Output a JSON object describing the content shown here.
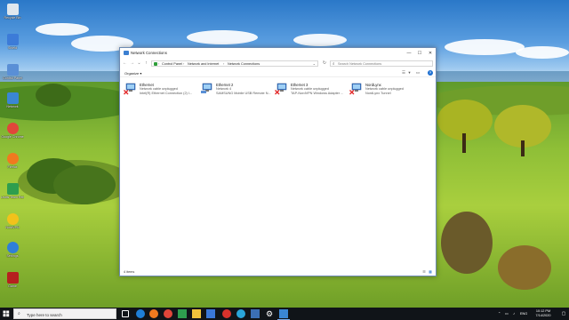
{
  "window": {
    "title": "Network Connections",
    "controls": {
      "minimize": "—",
      "maximize": "☐",
      "close": "✕"
    }
  },
  "addressbar": {
    "back": "←",
    "forward": "→",
    "recent": "⌄",
    "up": "↑",
    "crumbs": [
      "Control Panel",
      "Network and Internet",
      "Network Connections"
    ],
    "separator": "›",
    "dropdown": "⌄",
    "refresh": "↻",
    "search_placeholder": "Search Network Connections",
    "search_glyph": "⌕"
  },
  "commandbar": {
    "organize": "Organize ▾",
    "view_glyph": "☰",
    "view_dropdown": "▾",
    "pane_glyph": "▭",
    "help": "?"
  },
  "adapters": [
    {
      "name": "Ethernet",
      "status": "Network cable unplugged",
      "device": "Intel(R) Ethernet Connection (2) I..."
    },
    {
      "name": "Ethernet 2",
      "status": "Network 4",
      "device": "SAMSUNG Mobile USB Remote N..."
    },
    {
      "name": "Ethernet 3",
      "status": "Network cable unplugged",
      "device": "TAP-NordVPN Windows Adapter ..."
    },
    {
      "name": "NordLynx",
      "status": "Network cable unplugged",
      "device": "NordLynx Tunnel"
    }
  ],
  "statusbar": {
    "count": "4 items",
    "details_glyph": "☰",
    "tiles_glyph": "▦"
  },
  "desktop_icons": [
    {
      "label": "Recycle Bin",
      "icon": "recycle-bin-icon",
      "color": "#dfe7ee"
    },
    {
      "label": "Shield",
      "icon": "shield-app-icon",
      "color": "#3c7bd8"
    },
    {
      "label": "Control Panel",
      "icon": "control-panel-icon",
      "color": "#5a8fd6"
    },
    {
      "label": "Network",
      "icon": "network-icon",
      "color": "#3a86d4"
    },
    {
      "label": "Google Chrome",
      "icon": "chrome-icon",
      "color": "#e0463a"
    },
    {
      "label": "Firefox",
      "icon": "firefox-icon",
      "color": "#f07a1f"
    },
    {
      "label": "Lewis Team Remove",
      "icon": "green-app-icon",
      "color": "#2e9e4e"
    },
    {
      "label": "NordVPN",
      "icon": "yellow-app-icon",
      "color": "#f2c21b"
    },
    {
      "label": "Settings",
      "icon": "blue-app-icon",
      "color": "#2f7fd8"
    },
    {
      "label": "Game",
      "icon": "game-icon",
      "color": "#b6201f"
    }
  ],
  "taskbar": {
    "search_text": "Type here to search",
    "search_glyph": "⌕",
    "apps": [
      {
        "name": "task-view-icon",
        "color": "#ffffff"
      },
      {
        "name": "edge-icon",
        "color": "#1f7fd6"
      },
      {
        "name": "firefox-taskbar-icon",
        "color": "#f07a1f"
      },
      {
        "name": "chrome-taskbar-icon",
        "color": "#e0463a"
      },
      {
        "name": "file-explorer-icon",
        "color": "#f0c33c"
      },
      {
        "name": "mail-icon",
        "color": "#3a78d8"
      },
      {
        "name": "red-app-icon",
        "color": "#d9322c"
      },
      {
        "name": "globe-icon",
        "color": "#2aa5d9"
      },
      {
        "name": "settings-gear-icon",
        "color": "#ffffff"
      },
      {
        "name": "network-connections-taskbar-icon",
        "color": "#3a86d4"
      }
    ],
    "tray_glyphs": [
      "⌃",
      "▭",
      "♪"
    ],
    "language": "ENG",
    "time": "10:12 PM",
    "date": "7/14/2020",
    "notification_glyph": "▢"
  },
  "colors": {
    "accent": "#1e6fd0",
    "error": "#e32b2b",
    "taskbar": "#101418"
  }
}
